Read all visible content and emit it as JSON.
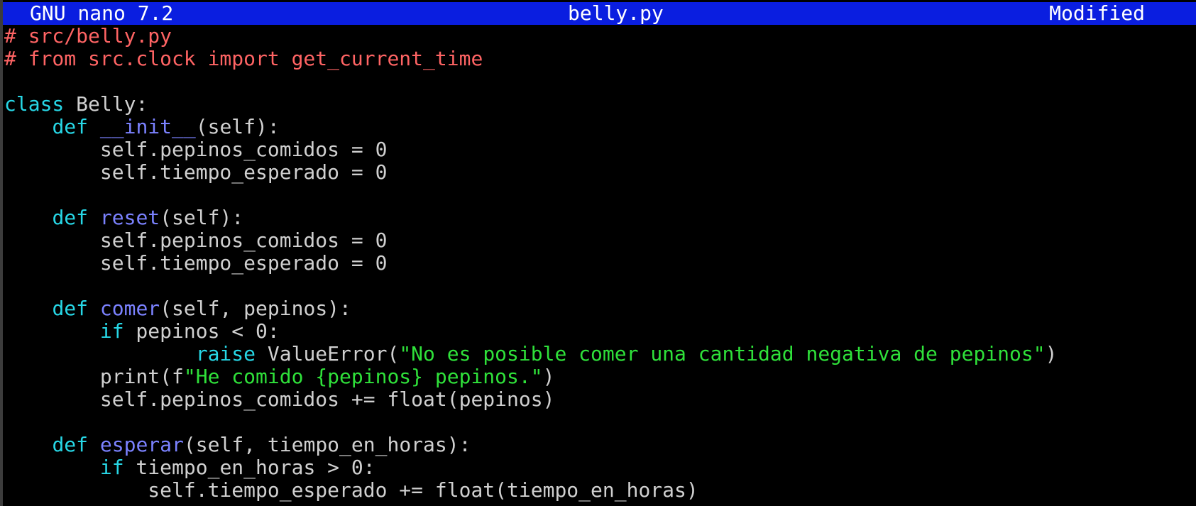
{
  "titlebar": {
    "app": "GNU nano 7.2",
    "filename": "belly.py",
    "status": "Modified"
  },
  "colors": {
    "titlebar_bg": "#0a1ee0",
    "background": "#000000",
    "comment": "#ff6464",
    "keyword": "#27d7e6",
    "function_name": "#7b82ff",
    "string": "#2fe13a",
    "text": "#d0d0d0"
  },
  "editor": {
    "lines": [
      [
        {
          "t": "# src/belly.py",
          "c": "comment"
        }
      ],
      [
        {
          "t": "# from src.clock import get_current_time",
          "c": "comment"
        }
      ],
      [],
      [
        {
          "t": "class",
          "c": "keyword"
        },
        {
          "t": " Belly:",
          "c": "plain"
        }
      ],
      [
        {
          "t": "    ",
          "c": "plain"
        },
        {
          "t": "def",
          "c": "keyword"
        },
        {
          "t": " ",
          "c": "plain"
        },
        {
          "t": "__init__",
          "c": "funcname"
        },
        {
          "t": "(self):",
          "c": "plain"
        }
      ],
      [
        {
          "t": "        self.pepinos_comidos = 0",
          "c": "plain"
        }
      ],
      [
        {
          "t": "        self.tiempo_esperado = 0",
          "c": "plain"
        }
      ],
      [],
      [
        {
          "t": "    ",
          "c": "plain"
        },
        {
          "t": "def",
          "c": "keyword"
        },
        {
          "t": " ",
          "c": "plain"
        },
        {
          "t": "reset",
          "c": "funcname"
        },
        {
          "t": "(self):",
          "c": "plain"
        }
      ],
      [
        {
          "t": "        self.pepinos_comidos = 0",
          "c": "plain"
        }
      ],
      [
        {
          "t": "        self.tiempo_esperado = 0",
          "c": "plain"
        }
      ],
      [],
      [
        {
          "t": "    ",
          "c": "plain"
        },
        {
          "t": "def",
          "c": "keyword"
        },
        {
          "t": " ",
          "c": "plain"
        },
        {
          "t": "comer",
          "c": "funcname"
        },
        {
          "t": "(self, pepinos):",
          "c": "plain"
        }
      ],
      [
        {
          "t": "        ",
          "c": "plain"
        },
        {
          "t": "if",
          "c": "keyword"
        },
        {
          "t": " pepinos < 0:",
          "c": "plain"
        }
      ],
      [
        {
          "t": "                ",
          "c": "plain"
        },
        {
          "t": "raise",
          "c": "keyword"
        },
        {
          "t": " ValueError(",
          "c": "plain"
        },
        {
          "t": "\"No es posible comer una cantidad negativa de pepinos\"",
          "c": "string"
        },
        {
          "t": ")",
          "c": "plain"
        }
      ],
      [
        {
          "t": "        print(f",
          "c": "plain"
        },
        {
          "t": "\"He comido {pepinos} pepinos.\"",
          "c": "string"
        },
        {
          "t": ")",
          "c": "plain"
        }
      ],
      [
        {
          "t": "        self.pepinos_comidos += float(pepinos)",
          "c": "plain"
        }
      ],
      [],
      [
        {
          "t": "    ",
          "c": "plain"
        },
        {
          "t": "def",
          "c": "keyword"
        },
        {
          "t": " ",
          "c": "plain"
        },
        {
          "t": "esperar",
          "c": "funcname"
        },
        {
          "t": "(self, tiempo_en_horas):",
          "c": "plain"
        }
      ],
      [
        {
          "t": "        ",
          "c": "plain"
        },
        {
          "t": "if",
          "c": "keyword"
        },
        {
          "t": " tiempo_en_horas > 0:",
          "c": "plain"
        }
      ],
      [
        {
          "t": "            self.tiempo_esperado += float(tiempo_en_horas)",
          "c": "plain"
        }
      ]
    ]
  }
}
